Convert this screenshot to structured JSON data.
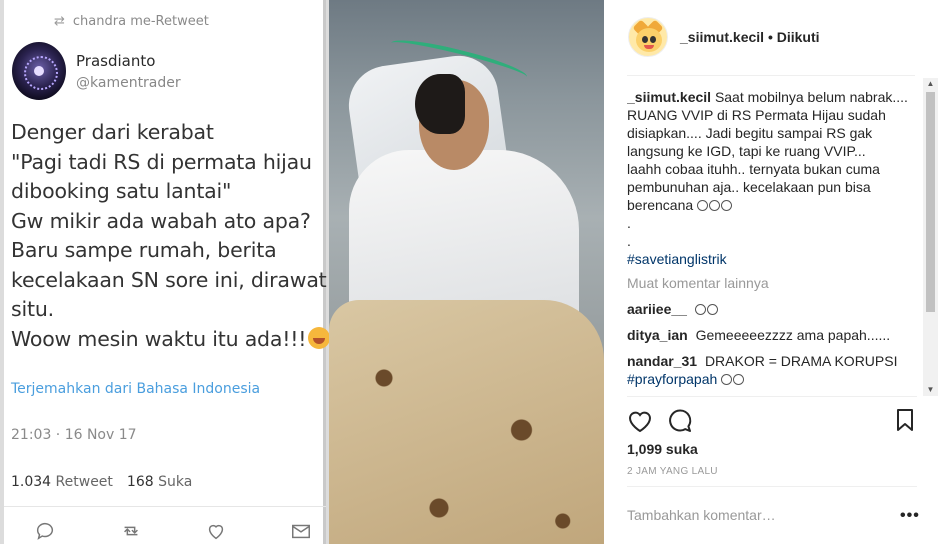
{
  "tweet": {
    "retweet_by": "chandra me-Retweet",
    "author_name": "Prasdianto",
    "author_handle": "@kamentrader",
    "lines": [
      "Denger dari kerabat",
      "\"Pagi tadi RS di permata hijau",
      "dibooking satu lantai\"",
      "Gw mikir ada wabah ato apa?",
      "Baru sampe rumah, berita",
      "kecelakaan SN sore ini, dirawat di",
      "situ.",
      "Woow mesin waktu itu ada!!!"
    ],
    "translate_label": "Terjemahkan dari Bahasa Indonesia",
    "timestamp": "21:03 · 16 Nov 17",
    "retweet_count": "1.034",
    "retweet_label": "Retweet",
    "like_count": "168",
    "like_label": "Suka"
  },
  "post": {
    "username": "_siimut.kecil",
    "follow_status": "• Diikuti",
    "caption_user": "_siimut.kecil",
    "caption_text": "Saat mobilnya belum nabrak.... RUANG VVIP di RS Permata Hijau sudah disiapkan.... Jadi begitu sampai RS gak langsung ke IGD, tapi ke ruang VVIP...",
    "caption_text_2": "laahh cobaa ituhh.. ternyata bukan cuma pembunuhan aja.. kecelakaan pun bisa berencana",
    "caption_dot_1": ".",
    "caption_dot_2": ".",
    "hashtag": "#savetianglistrik",
    "load_more": "Muat komentar lainnya",
    "comments": [
      {
        "user": "aariiee__",
        "text": ""
      },
      {
        "user": "ditya_ian",
        "text": "Gemeeeeezzzz ama papah......"
      },
      {
        "user": "nandar_31",
        "text": "DRAKOR = DRAMA KORUPSI"
      }
    ],
    "partial_hashtag": "#prayforpapah",
    "likes": "1,099 suka",
    "time_ago": "2 JAM YANG LALU",
    "comment_placeholder": "Tambahkan komentar…",
    "more_options": "•••"
  },
  "icons": {
    "like": "heart-icon",
    "comment": "comment-bubble-icon",
    "save": "bookmark-icon",
    "retweet": "retweet-icon"
  },
  "colors": {
    "hashtag": "#003569",
    "tweet_link": "#4a9ede",
    "muted": "#999999"
  }
}
